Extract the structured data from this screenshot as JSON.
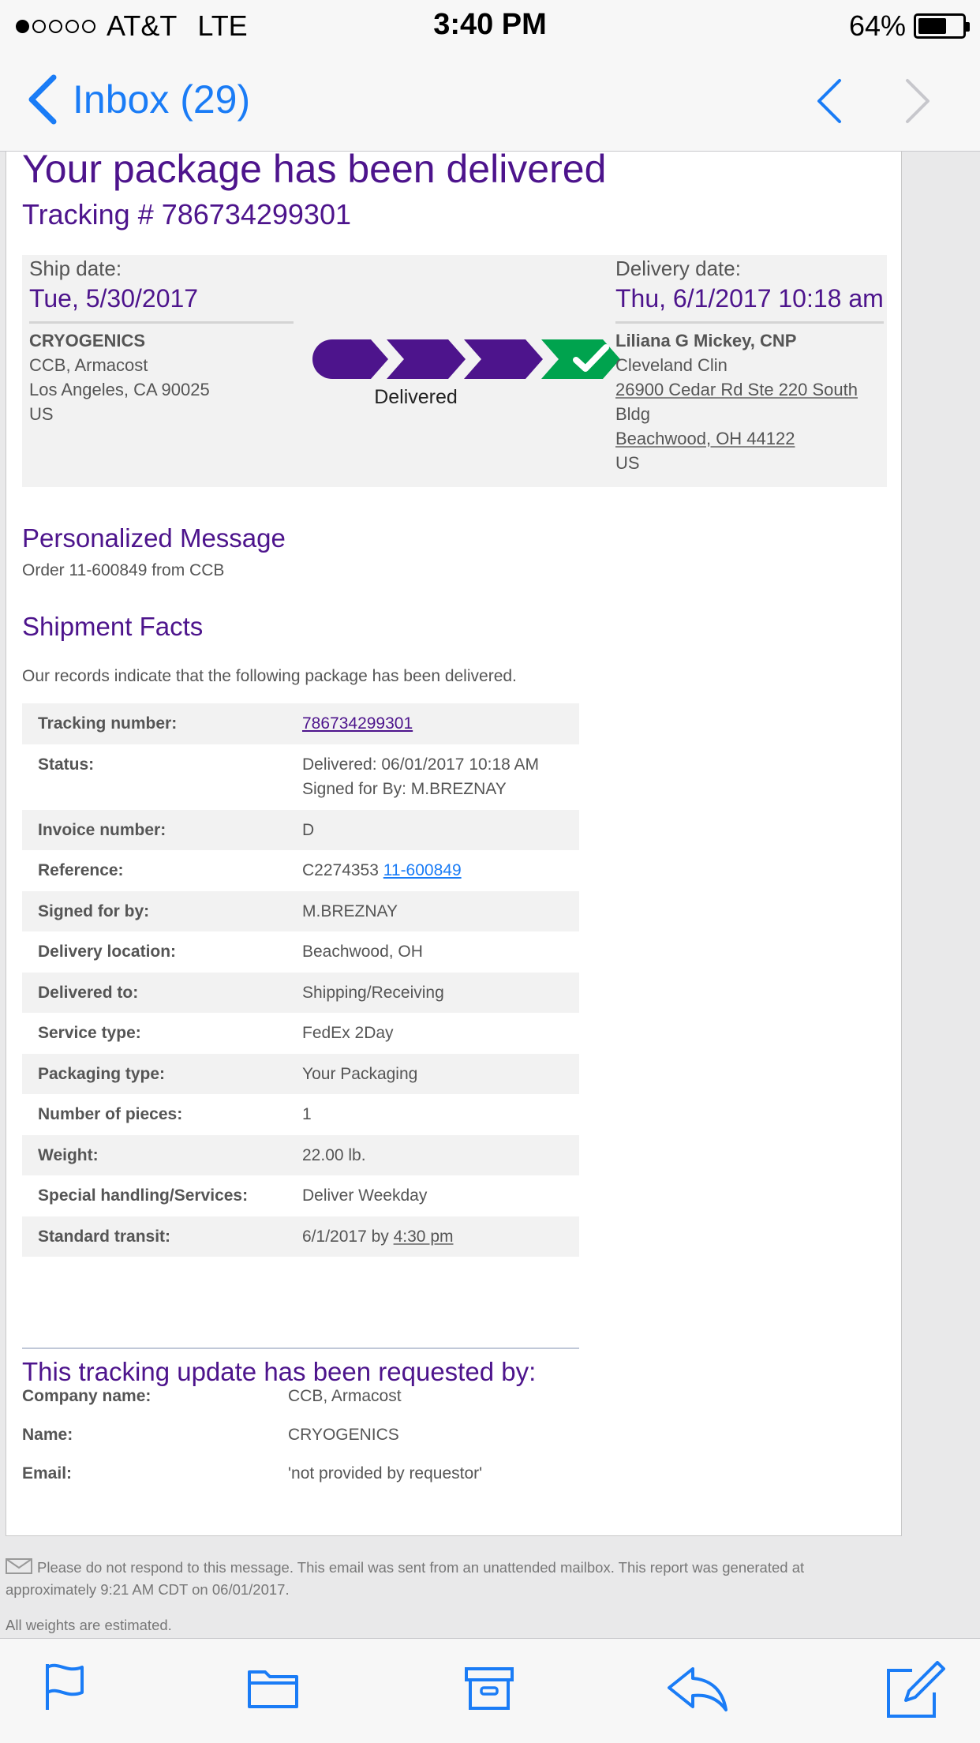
{
  "status_bar": {
    "carrier": "AT&T",
    "network": "LTE",
    "time": "3:40 PM",
    "battery": "64%",
    "battery_level": 0.64
  },
  "nav": {
    "back_label": "Inbox (29)",
    "accent_color": "#1a7cf6"
  },
  "email": {
    "title": "Your package has been delivered",
    "tracking_header": "Tracking # 786734299301",
    "brand_color": "#4d148c",
    "ship": {
      "label": "Ship date:",
      "date": "Tue, 5/30/2017",
      "name": "CRYOGENICS",
      "line1": "CCB, Armacost",
      "line2": "Los Angeles, CA 90025",
      "country": "US"
    },
    "progress": {
      "status": "Delivered",
      "steps_total": 4,
      "steps_complete": 4,
      "colors": {
        "step": "#4d148c",
        "done": "#00a34e"
      }
    },
    "delivery": {
      "label": "Delivery date:",
      "date": "Thu, 6/1/2017 10:18 am",
      "name": "Liliana G Mickey, CNP",
      "line1": "Cleveland Clin",
      "line2": "26900 Cedar Rd Ste 220 South",
      "line3": "Bldg",
      "line4": "Beachwood, OH 44122",
      "country": "US"
    },
    "personalized": {
      "heading": "Personalized Message",
      "text": "Order 11-600849 from CCB"
    },
    "facts": {
      "heading": "Shipment Facts",
      "intro": "Our records indicate that the following package has been delivered.",
      "rows": [
        {
          "label": "Tracking number:",
          "value": "786734299301"
        },
        {
          "label": "Status:",
          "value": "Delivered: 06/01/2017 10:18 AM Signed for By: M.BREZNAY"
        },
        {
          "label": "Invoice number:",
          "value": "D"
        },
        {
          "label": "Reference:",
          "value": "C2274353",
          "link": "11-600849"
        },
        {
          "label": "Signed for by:",
          "value": "M.BREZNAY"
        },
        {
          "label": "Delivery location:",
          "value": "Beachwood, OH"
        },
        {
          "label": "Delivered to:",
          "value": "Shipping/Receiving"
        },
        {
          "label": "Service type:",
          "value": "FedEx 2Day"
        },
        {
          "label": "Packaging type:",
          "value": "Your Packaging"
        },
        {
          "label": "Number of pieces:",
          "value": "1"
        },
        {
          "label": "Weight:",
          "value": "22.00 lb."
        },
        {
          "label": "Special handling/Services:",
          "value": "Deliver Weekday"
        },
        {
          "label": "Standard transit:",
          "value": "6/1/2017 by",
          "time": "4:30 pm"
        }
      ]
    },
    "requested": {
      "heading": "This tracking update has been requested by:",
      "rows": [
        {
          "label": "Company name:",
          "value": "CCB, Armacost"
        },
        {
          "label": "Name:",
          "value": "CRYOGENICS"
        },
        {
          "label": "Email:",
          "value": "'not provided by requestor'"
        }
      ]
    },
    "footer": {
      "note": "Please do not respond to this message. This email was sent from an unattended mailbox. This report was generated at approximately 9:21 AM CDT on 06/01/2017.",
      "weights": "All weights are estimated."
    }
  },
  "toolbar": {
    "icons": [
      "flag-icon",
      "folder-icon",
      "archive-icon",
      "reply-icon",
      "compose-icon"
    ]
  }
}
